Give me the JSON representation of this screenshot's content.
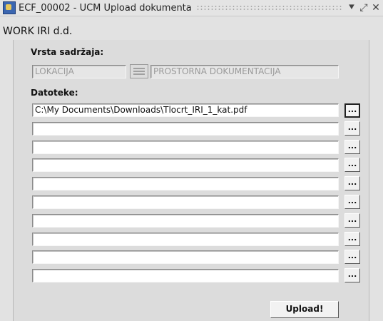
{
  "window": {
    "title": "ECF_00002 - UCM Upload dokumenta",
    "minimize_glyph": "⯆",
    "maximize_glyph": "⤢",
    "close_glyph": "✕"
  },
  "company": "WORK IRI d.d.",
  "content_type": {
    "label": "Vrsta sadržaja:",
    "code": "LOKACIJA",
    "name": "PROSTORNA DOKUMENTACIJA"
  },
  "files": {
    "label": "Datoteke:",
    "browse_label": "...",
    "rows": [
      "C:\\My Documents\\Downloads\\Tlocrt_IRI_1_kat.pdf",
      "",
      "",
      "",
      "",
      "",
      "",
      "",
      "",
      ""
    ]
  },
  "upload_label": "Upload!"
}
